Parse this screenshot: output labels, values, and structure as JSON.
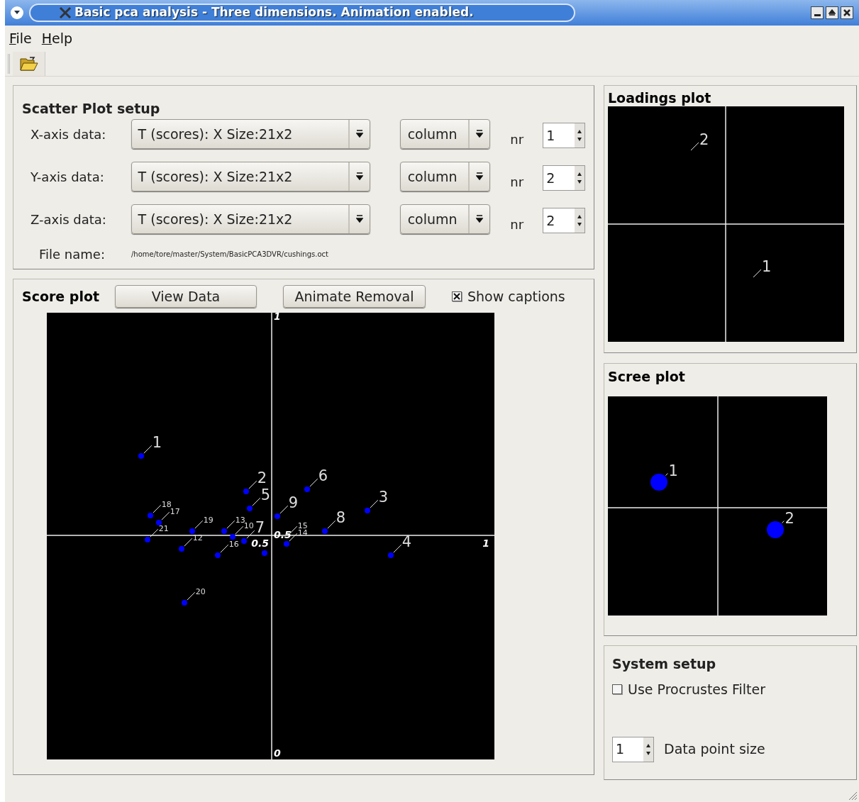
{
  "window": {
    "title": "Basic pca analysis - Three dimensions. Animation enabled."
  },
  "menu": [
    {
      "label": "File"
    },
    {
      "label": "Help"
    }
  ],
  "scatter_setup": {
    "title": "Scatter Plot setup",
    "rows": [
      {
        "label": "X-axis data:",
        "source": "T (scores): X Size:21x2",
        "component": "column",
        "nr_label": "nr",
        "nr": "1"
      },
      {
        "label": "Y-axis data:",
        "source": "T (scores): X Size:21x2",
        "component": "column",
        "nr_label": "nr",
        "nr": "2"
      },
      {
        "label": "Z-axis data:",
        "source": "T (scores): X Size:21x2",
        "component": "column",
        "nr_label": "nr",
        "nr": "2"
      }
    ],
    "file_label": "File name:",
    "file_name": "/home/tore/master/System/BasicPCA3DVR/cushings.oct"
  },
  "score_plot": {
    "title": "Score plot",
    "buttons": [
      "View Data",
      "Animate Removal"
    ],
    "show_captions": {
      "label": "Show captions",
      "checked": true
    },
    "tick_labels": [
      "1",
      "0.5",
      "0.5",
      "1",
      "0"
    ],
    "points": [
      {
        "caption": "1"
      },
      {
        "caption": "2"
      },
      {
        "caption": "3"
      },
      {
        "caption": "4"
      },
      {
        "caption": "5"
      },
      {
        "caption": "6"
      },
      {
        "caption": "7"
      },
      {
        "caption": "8"
      },
      {
        "caption": "9"
      },
      {
        "caption": "10"
      },
      {
        "caption": "12"
      },
      {
        "caption": "13"
      },
      {
        "caption": "14"
      },
      {
        "caption": "15"
      },
      {
        "caption": "16"
      },
      {
        "caption": "17"
      },
      {
        "caption": "18"
      },
      {
        "caption": "19"
      },
      {
        "caption": "20"
      },
      {
        "caption": "21"
      }
    ]
  },
  "loadings_plot": {
    "title": "Loadings plot",
    "points": [
      {
        "caption": "2"
      },
      {
        "caption": "1"
      }
    ]
  },
  "scree_plot": {
    "title": "Scree plot",
    "points": [
      {
        "caption": "1"
      },
      {
        "caption": "2"
      }
    ]
  },
  "system_setup": {
    "title": "System setup",
    "procrustes": {
      "label": "Use Procrustes Filter",
      "checked": false
    },
    "point_size": {
      "value": "1",
      "label": "Data point size"
    }
  }
}
